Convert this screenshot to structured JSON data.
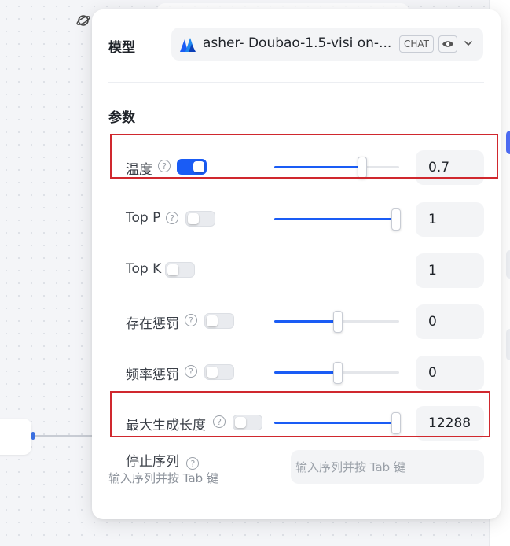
{
  "model": {
    "label": "模型",
    "selected": "asher- Doubao-1.5-visi on-...",
    "badge_chat": "CHAT",
    "logo_icon": "model-logo-icon",
    "visible_icon": "eye-icon",
    "dropdown_icon": "chevron-down-icon"
  },
  "params": {
    "title": "参数",
    "rows": [
      {
        "label": "温度",
        "enabled": true,
        "slider_fraction": 0.7,
        "value": "0.7",
        "has_slider": true
      },
      {
        "label": "Top P",
        "enabled": false,
        "slider_fraction": 1.0,
        "value": "1",
        "has_slider": true
      },
      {
        "label": "Top K",
        "enabled": false,
        "value": "1",
        "has_slider": false
      },
      {
        "label": "存在惩罚",
        "enabled": false,
        "slider_fraction": 0.5,
        "value": "0",
        "has_slider": true
      },
      {
        "label": "频率惩罚",
        "enabled": false,
        "slider_fraction": 0.5,
        "value": "0",
        "has_slider": true
      },
      {
        "label": "最大生成长度",
        "enabled": false,
        "slider_fraction": 1.0,
        "value": "12288",
        "has_slider": true
      }
    ]
  },
  "stop_sequence": {
    "label": "停止序列",
    "hint": "输入序列并按 Tab 键",
    "placeholder": "输入序列并按 Tab 键"
  },
  "help_glyph": "?",
  "colors": {
    "accent": "#1a5cf5",
    "highlight": "#d0282e",
    "panel_bg": "#ffffff",
    "field_bg": "#f3f4f6"
  }
}
